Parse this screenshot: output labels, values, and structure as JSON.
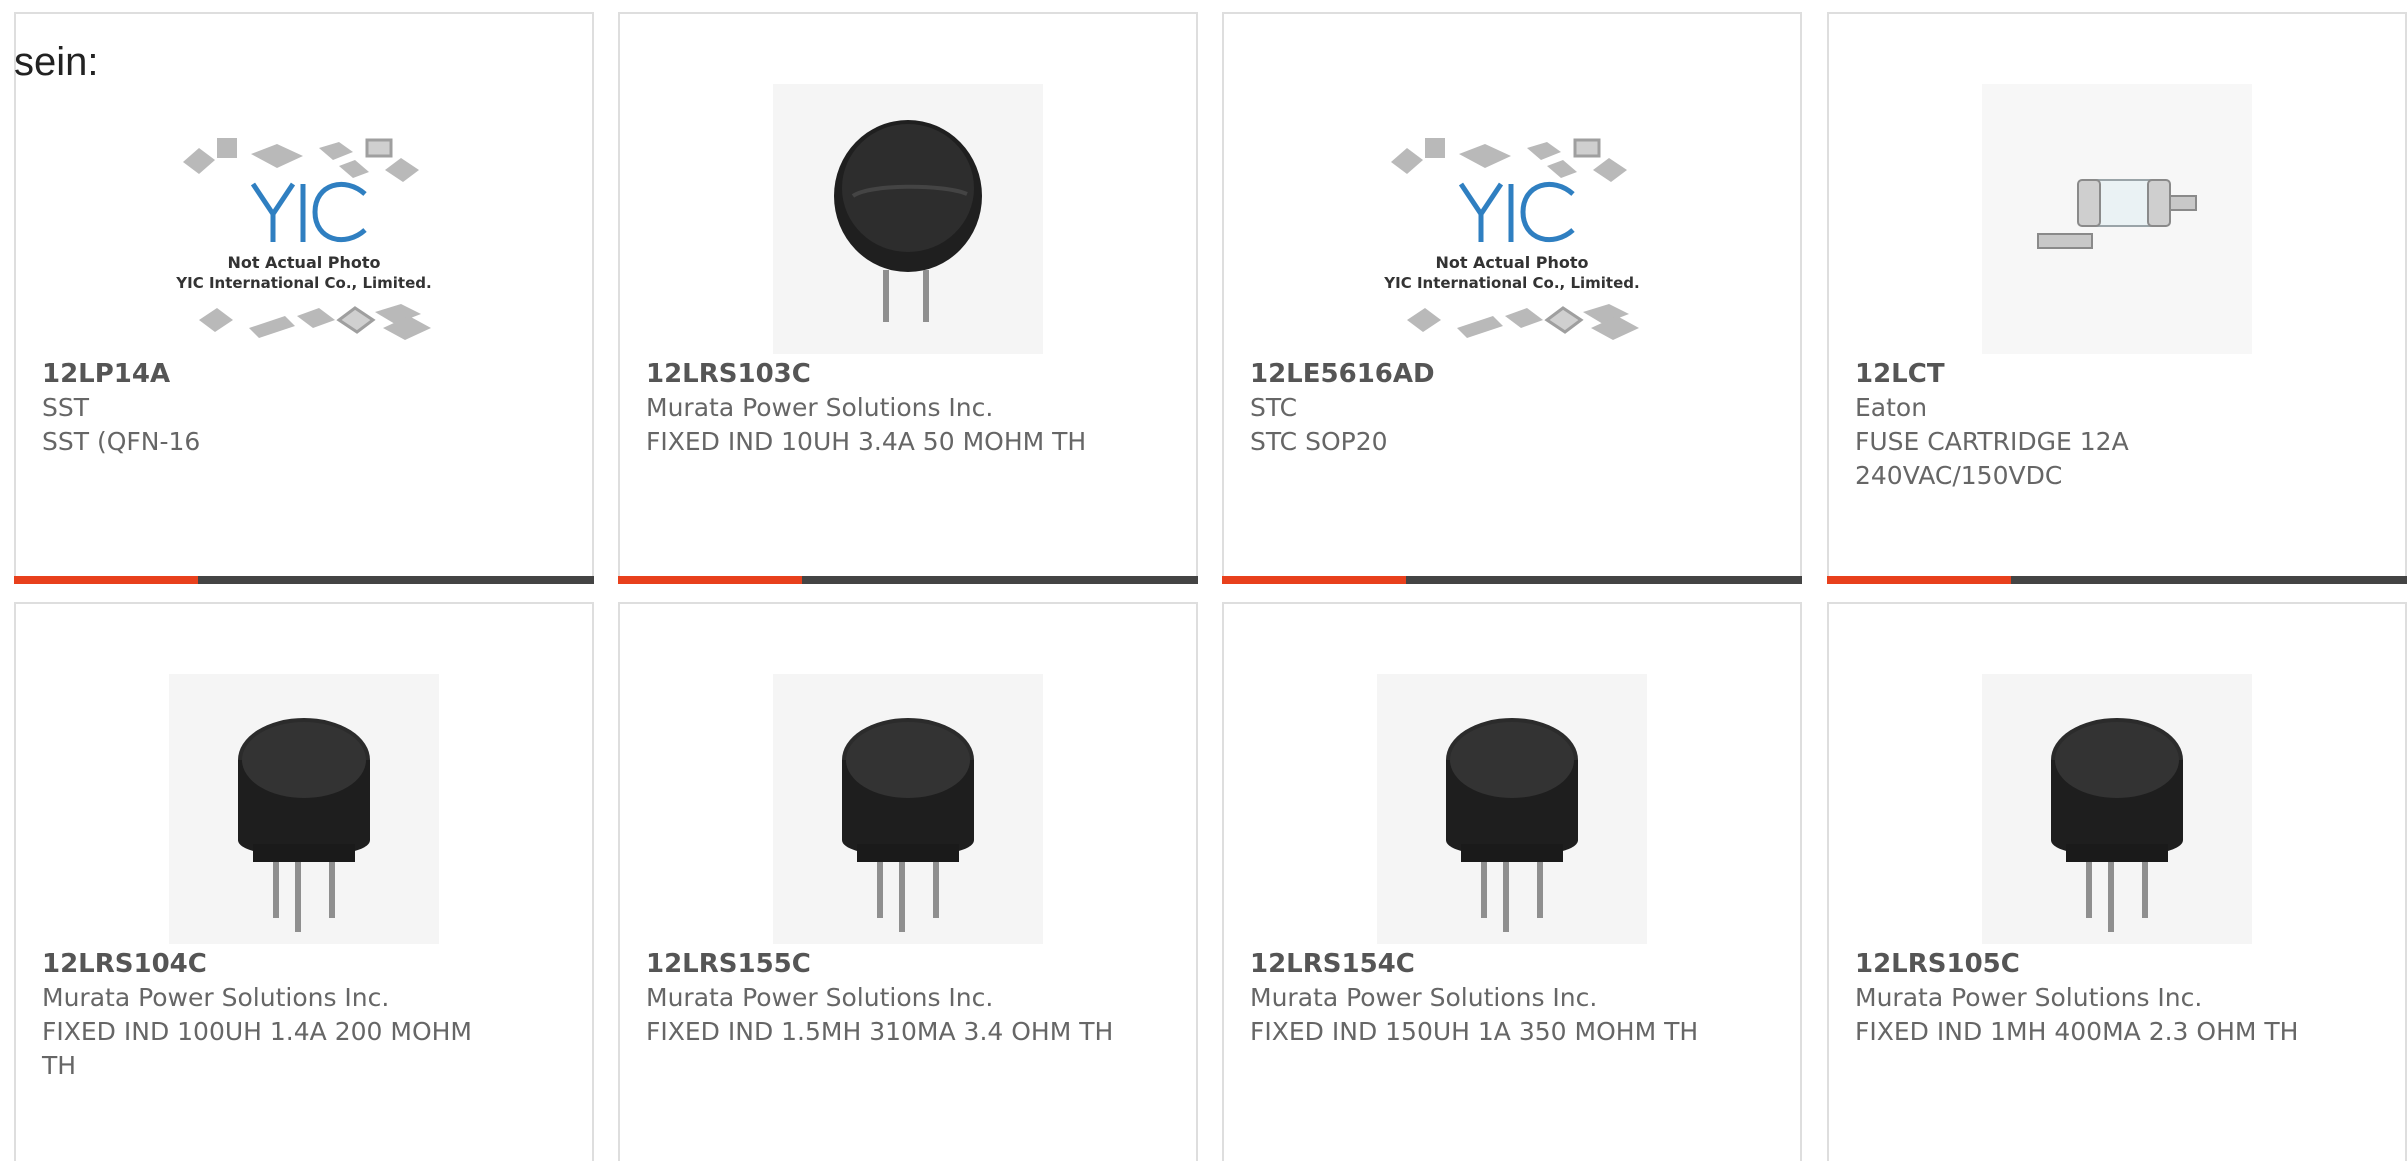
{
  "page_prefix": "sein:",
  "colors": {
    "accent": "#e8401c",
    "bar": "#444444",
    "border": "#dedede"
  },
  "placeholder": {
    "line1": "Not Actual Photo",
    "line2": "YIC International Co., Limited.",
    "logo_text": "YIC"
  },
  "products": [
    {
      "part": "12LP14A",
      "maker": "SST",
      "desc": "SST (QFN-16",
      "image": "placeholder-logo"
    },
    {
      "part": "12LRS103C",
      "maker": "Murata Power Solutions Inc.",
      "desc": "FIXED IND 10UH 3.4A 50 MOHM TH",
      "image": "inductor-top-view"
    },
    {
      "part": "12LE5616AD",
      "maker": "STC",
      "desc": "STC SOP20",
      "image": "placeholder-logo"
    },
    {
      "part": "12LCT",
      "maker": "Eaton",
      "desc": "FUSE CARTRIDGE 12A 240VAC/150VDC",
      "image": "fuse-cartridge"
    },
    {
      "part": "12LRS104C",
      "maker": "Murata Power Solutions Inc.",
      "desc": "FIXED IND 100UH 1.4A 200 MOHM TH",
      "image": "inductor-side-view"
    },
    {
      "part": "12LRS155C",
      "maker": "Murata Power Solutions Inc.",
      "desc": "FIXED IND 1.5MH 310MA 3.4 OHM TH",
      "image": "inductor-side-view"
    },
    {
      "part": "12LRS154C",
      "maker": "Murata Power Solutions Inc.",
      "desc": "FIXED IND 150UH 1A 350 MOHM TH",
      "image": "inductor-side-view"
    },
    {
      "part": "12LRS105C",
      "maker": "Murata Power Solutions Inc.",
      "desc": "FIXED IND 1MH 400MA 2.3 OHM TH",
      "image": "inductor-side-view"
    }
  ]
}
